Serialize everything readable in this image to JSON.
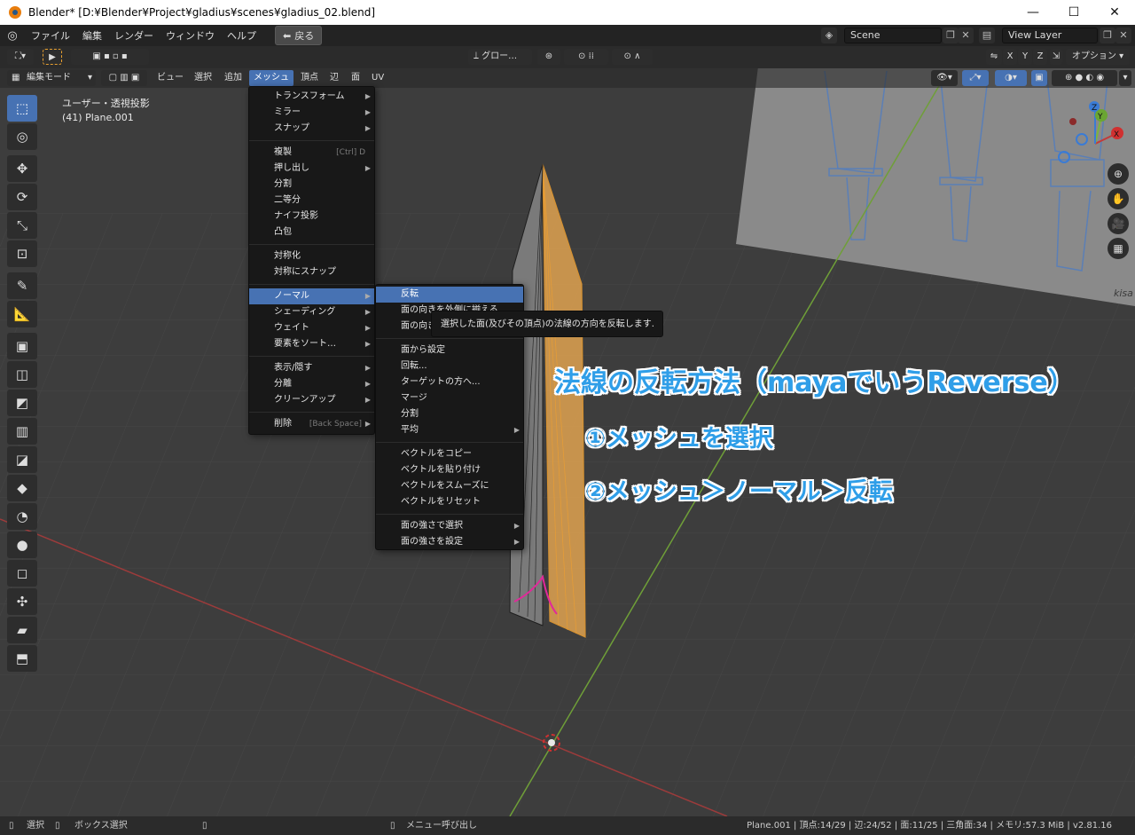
{
  "window": {
    "title": "Blender* [D:¥Blender¥Project¥gladius¥scenes¥gladius_02.blend]",
    "minimize": "—",
    "maximize": "☐",
    "close": "✕"
  },
  "topmenu": {
    "items": [
      "ファイル",
      "編集",
      "レンダー",
      "ウィンドウ",
      "ヘルプ"
    ],
    "back_label": "戻る",
    "scene": "Scene",
    "view_layer": "View Layer"
  },
  "header": {
    "transform_orientation": "グロー…",
    "options": "オプション",
    "axes": [
      "X",
      "Y",
      "Z"
    ]
  },
  "edit_header": {
    "mode": "編集モード",
    "menus": [
      "ビュー",
      "選択",
      "追加",
      "メッシュ",
      "頂点",
      "辺",
      "面",
      "UV"
    ]
  },
  "viewport": {
    "view_name": "ユーザー・透視投影",
    "object_name": "(41) Plane.001",
    "ref_watermark": "kisa",
    "gizmo_axes": [
      "X",
      "Y",
      "Z"
    ]
  },
  "mesh_menu": {
    "groups": [
      [
        {
          "label": "トランスフォーム",
          "sub": true
        },
        {
          "label": "ミラー",
          "sub": true
        },
        {
          "label": "スナップ",
          "sub": true
        }
      ],
      [
        {
          "label": "複製",
          "shortcut": "[Ctrl] D"
        },
        {
          "label": "押し出し",
          "sub": true
        },
        {
          "label": "分割"
        },
        {
          "label": "二等分"
        },
        {
          "label": "ナイフ投影"
        },
        {
          "label": "凸包"
        }
      ],
      [
        {
          "label": "対称化"
        },
        {
          "label": "対称にスナップ"
        }
      ],
      [
        {
          "label": "ノーマル",
          "sub": true,
          "highlight": true
        },
        {
          "label": "シェーディング",
          "sub": true
        },
        {
          "label": "ウェイト",
          "sub": true
        },
        {
          "label": "要素をソート…",
          "sub": true
        }
      ],
      [
        {
          "label": "表示/隠す",
          "sub": true
        },
        {
          "label": "分離",
          "sub": true
        },
        {
          "label": "クリーンアップ",
          "sub": true
        }
      ],
      [
        {
          "label": "削除",
          "shortcut": "[Back Space]",
          "sub": true
        }
      ]
    ]
  },
  "normal_menu": {
    "groups": [
      [
        {
          "label": "反転",
          "highlight": true
        },
        {
          "label": "面の向きを外側に揃える"
        },
        {
          "label": "面の向き"
        }
      ],
      [
        {
          "label": "面から設定"
        },
        {
          "label": "回転..."
        },
        {
          "label": "ターゲットの方へ..."
        },
        {
          "label": "マージ"
        },
        {
          "label": "分割"
        },
        {
          "label": "平均",
          "sub": true
        }
      ],
      [
        {
          "label": "ベクトルをコピー"
        },
        {
          "label": "ベクトルを貼り付け"
        },
        {
          "label": "ベクトルをスムーズに"
        },
        {
          "label": "ベクトルをリセット"
        }
      ],
      [
        {
          "label": "面の強さで選択",
          "sub": true
        },
        {
          "label": "面の強さを設定",
          "sub": true
        }
      ]
    ]
  },
  "tooltip": "選択した面(及びその頂点)の法線の方向を反転します.",
  "annotation": {
    "title": "法線の反転方法（mayaでいうReverse）",
    "step1": "①メッシュを選択",
    "step2": "②メッシュ＞ノーマル＞反転"
  },
  "status": {
    "select": "選択",
    "box_select": "ボックス選択",
    "call_menu": "メニュー呼び出し",
    "stats": "Plane.001 | 頂点:14/29 | 辺:24/52 | 面:11/25 | 三角面:34 | メモリ:57.3 MiB | v2.81.16"
  },
  "colors": {
    "accent": "#4772b3",
    "menu_bg": "#181818",
    "x_axis": "#c43a3a",
    "y_axis": "#7cb53d",
    "selection": "#f2a33a",
    "annotation": "#2f9ee8"
  }
}
